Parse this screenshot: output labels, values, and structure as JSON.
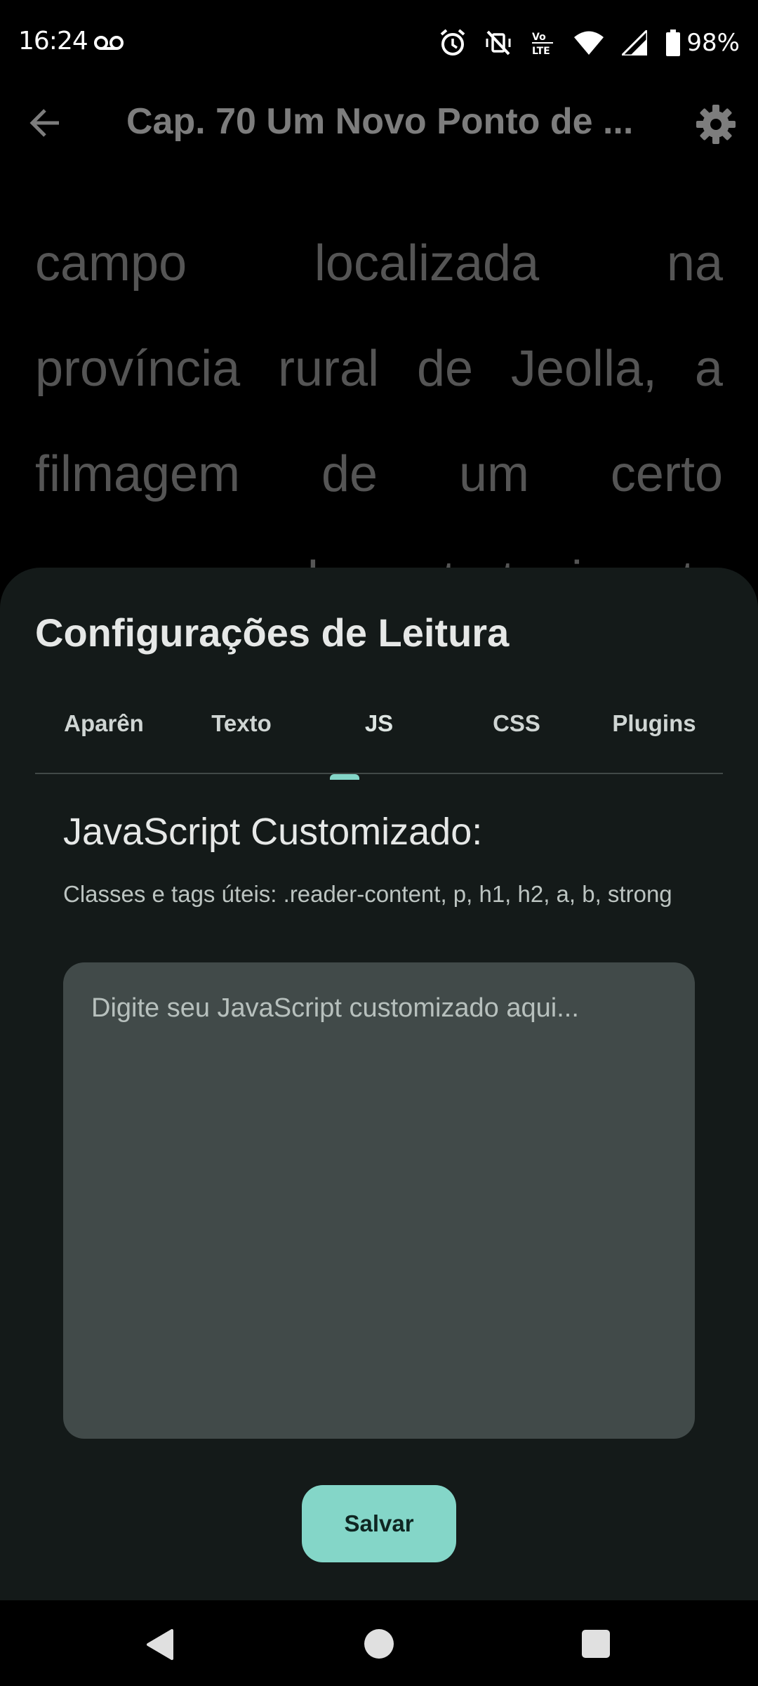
{
  "status_bar": {
    "time": "16:24",
    "battery": "98%",
    "icons": [
      "voicemail-icon",
      "alarm-icon",
      "vibrate-off-icon",
      "volte-icon",
      "wifi-icon",
      "signal-icon",
      "battery-icon"
    ],
    "volte_label": "LTE"
  },
  "app_bar": {
    "title": "Cap. 70 Um Novo Ponto de ...",
    "back_icon": "arrow-back-icon",
    "settings_icon": "gear-icon"
  },
  "reader": {
    "lines": [
      [
        "campo",
        "localizada",
        "na"
      ],
      [
        "província",
        "rural",
        "de",
        "Jeolla,",
        "a"
      ],
      [
        "filmagem",
        "de",
        "um",
        "certo"
      ],
      [
        "programa",
        "de",
        "entretenimento"
      ]
    ]
  },
  "sheet": {
    "title": "Configurações de Leitura",
    "tabs": [
      {
        "label": "Aparên",
        "active": false
      },
      {
        "label": "Texto",
        "active": false
      },
      {
        "label": "JS",
        "active": true
      },
      {
        "label": "CSS",
        "active": false
      },
      {
        "label": "Plugins",
        "active": false
      }
    ],
    "heading": "JavaScript Customizado:",
    "help": "Classes e tags úteis: .reader-content, p, h1, h2, a, b, strong",
    "editor": {
      "value": "",
      "placeholder": "Digite seu JavaScript customizado aqui..."
    },
    "save_label": "Salvar"
  },
  "colors": {
    "accent": "#84d6c8",
    "sheet_bg": "#141a19",
    "editor_bg": "#414a49"
  }
}
